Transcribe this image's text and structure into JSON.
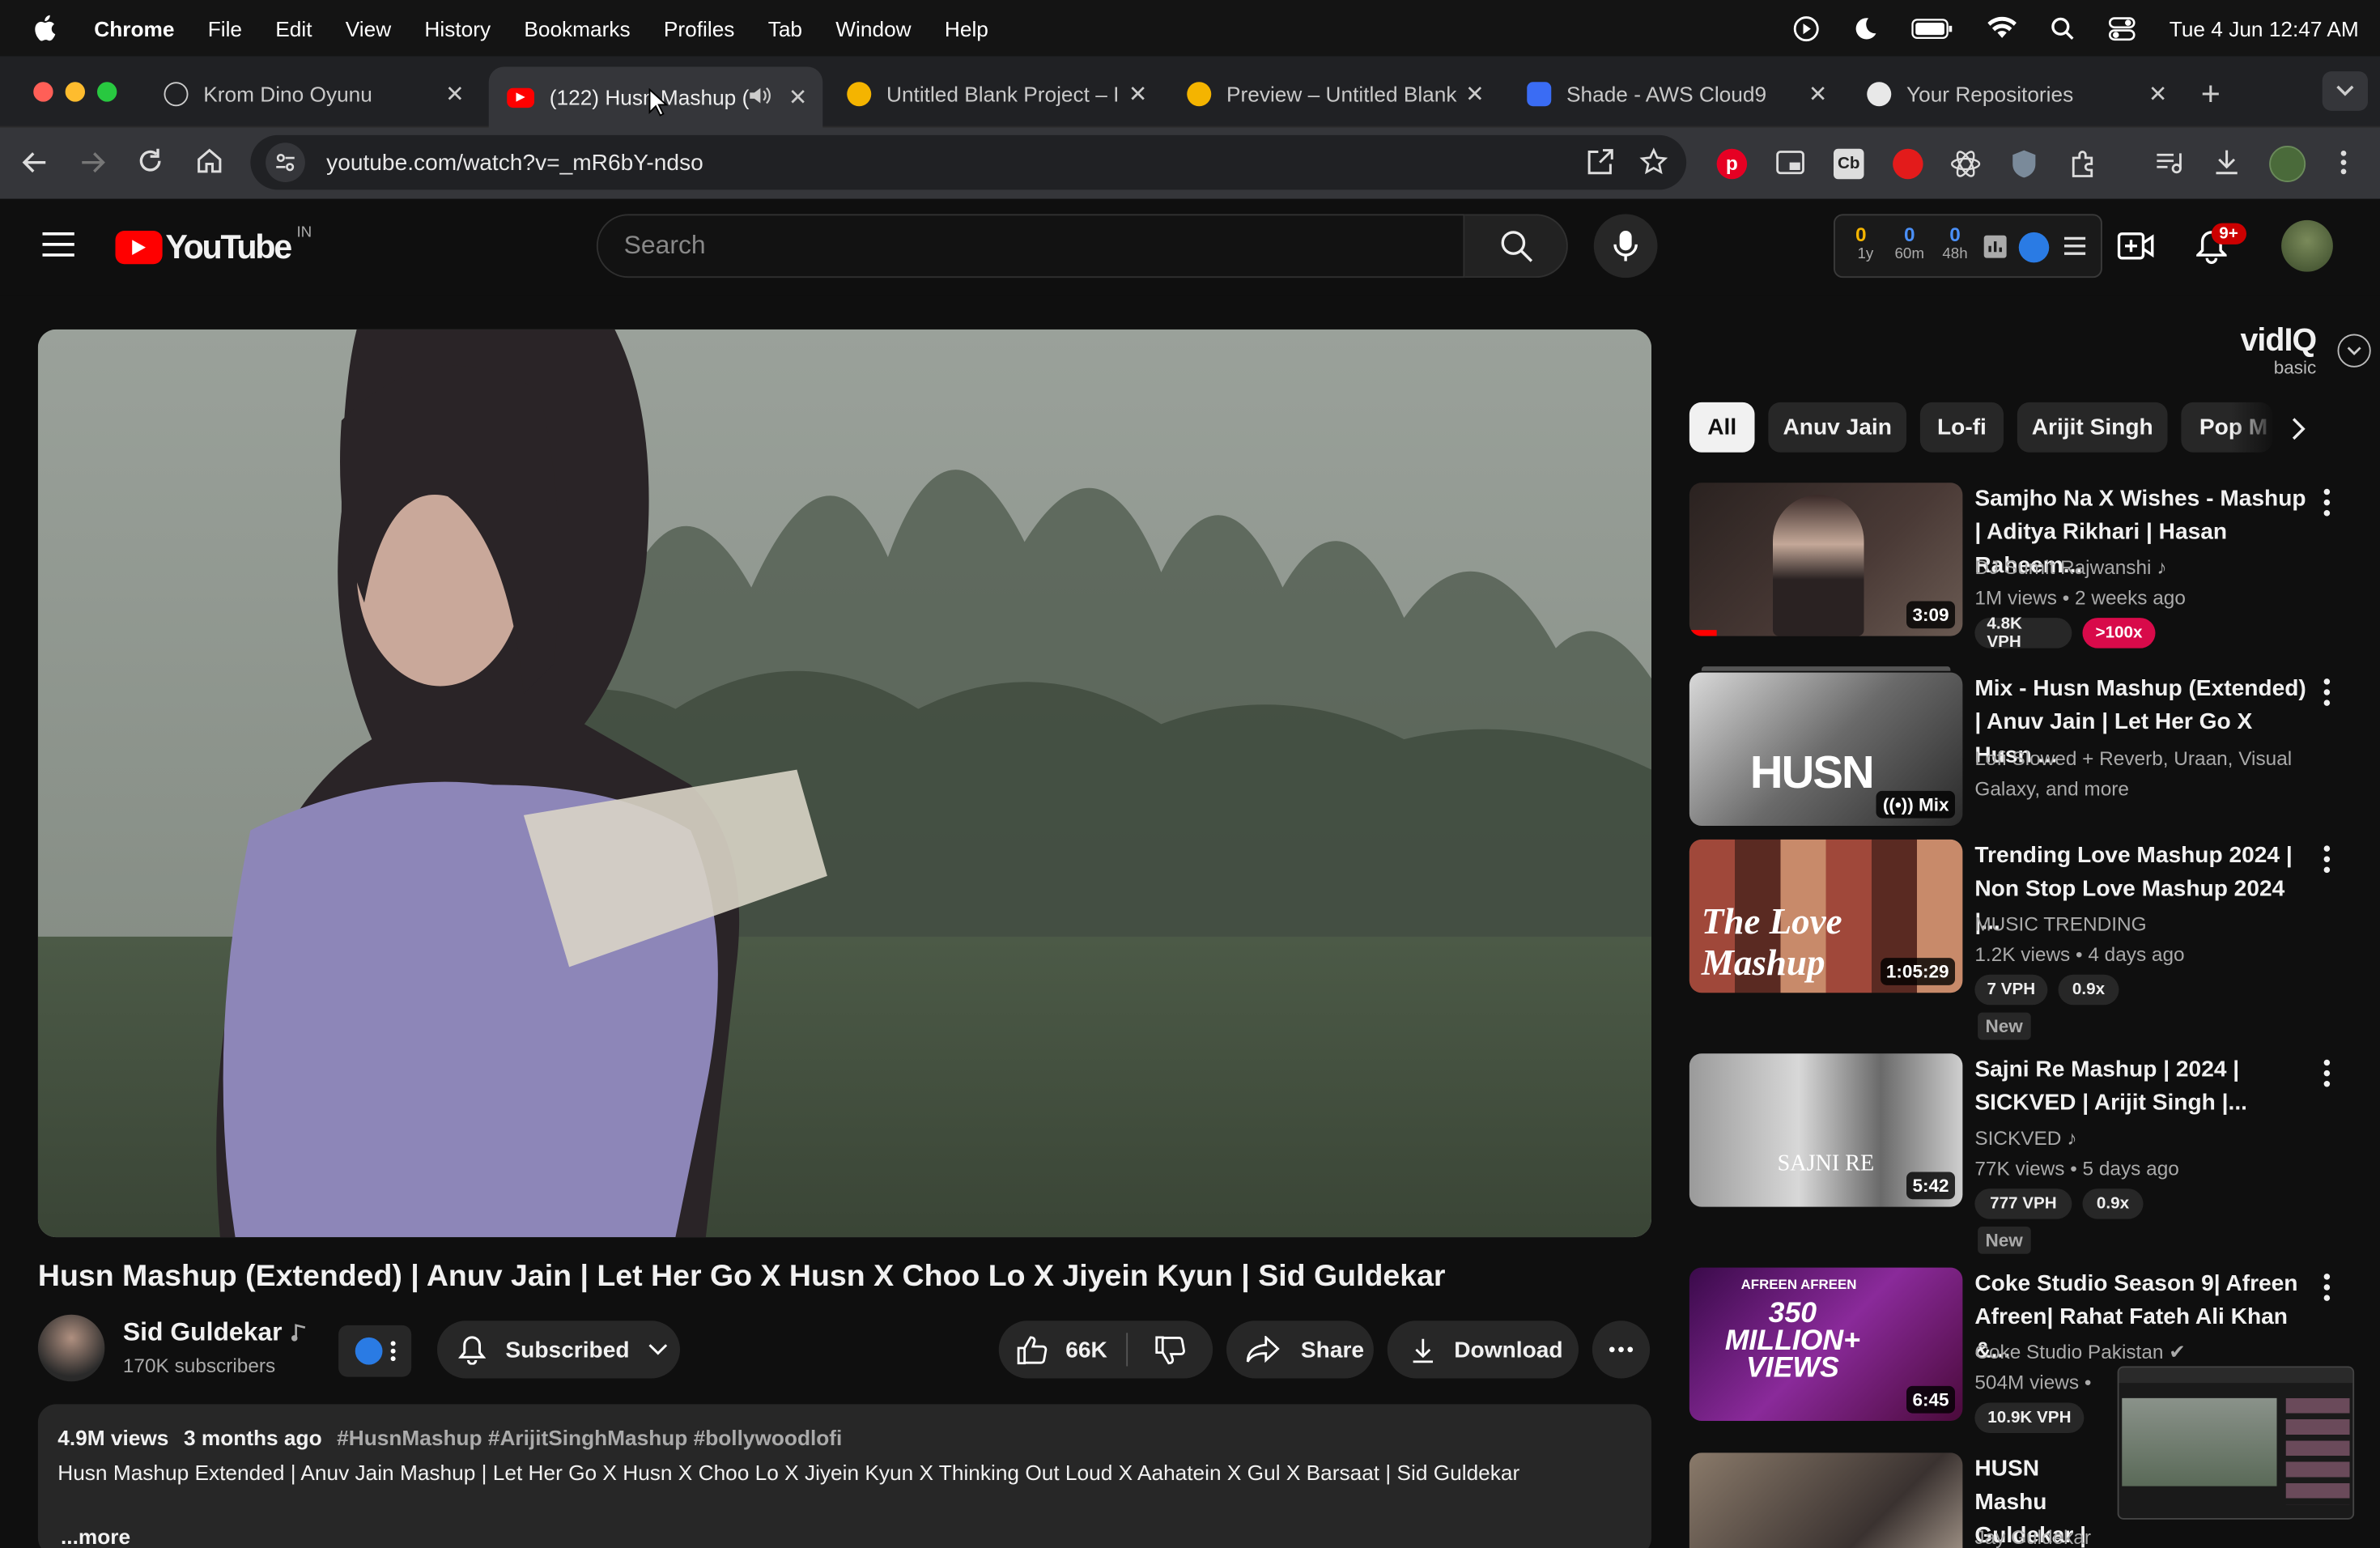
{
  "menubar": {
    "app": "Chrome",
    "items": [
      "File",
      "Edit",
      "View",
      "History",
      "Bookmarks",
      "Profiles",
      "Tab",
      "Window",
      "Help"
    ],
    "clock": "Tue 4 Jun  12:47 AM"
  },
  "tabs": [
    {
      "title": "Krom Dino Oyunu",
      "favicon": "openai-icon"
    },
    {
      "title": "(122) Husn Mashup (",
      "favicon": "youtube-icon"
    },
    {
      "title": "Untitled Blank Project – I",
      "favicon": "replit-icon"
    },
    {
      "title": "Preview – Untitled Blank",
      "favicon": "replit-icon"
    },
    {
      "title": "Shade - AWS Cloud9",
      "favicon": "cloud9-icon"
    },
    {
      "title": "Your Repositories",
      "favicon": "github-icon"
    }
  ],
  "toolbar": {
    "url": "youtube.com/watch?v=_mR6bY-ndso"
  },
  "youtube": {
    "logo_text": "YouTube",
    "country": "IN",
    "search_placeholder": "Search",
    "notifications": "9+",
    "vidiq": {
      "stats": [
        {
          "value": "0",
          "label": "1y"
        },
        {
          "value": "0",
          "label": "60m"
        },
        {
          "value": "0",
          "label": "48h"
        }
      ],
      "brand": "vidIQ",
      "plan": "basic"
    }
  },
  "video": {
    "title": "Husn Mashup (Extended) | Anuv Jain | Let Her Go X Husn X Choo Lo X Jiyein Kyun | Sid Guldekar",
    "channel": "Sid Guldekar",
    "subscribers": "170K subscribers",
    "subscribed_label": "Subscribed",
    "likes": "66K",
    "share_label": "Share",
    "download_label": "Download",
    "views": "4.9M views",
    "age": "3 months ago",
    "hashtags": "#HusnMashup #ArijitSinghMashup #bollywoodlofi",
    "description": "Husn Mashup Extended | Anuv Jain Mashup | Let Her Go X Husn X Choo Lo X Jiyein Kyun X Thinking Out Loud X Aahatein X Gul X Barsaat | Sid Guldekar",
    "more": "...more"
  },
  "chips": [
    "All",
    "Anuv Jain",
    "Lo-fi",
    "Arijit Singh",
    "Pop M"
  ],
  "recommendations": [
    {
      "title": "Samjho Na X Wishes - Mashup | Aditya Rikhari | Hasan Raheem...",
      "channel": "DJ Sumit Rajwanshi",
      "stats": "1M views  • 2 weeks ago",
      "duration": "3:09",
      "vph": "4.8K VPH",
      "ratio": ">100x",
      "thumb_color": "#3b3230"
    },
    {
      "title": "Mix - Husn Mashup (Extended) | Anuv Jain | Let Her Go X Husn ...",
      "channel": "Lofi Slowed + Reverb, Uraan, Visual",
      "stats": "Galaxy, and more",
      "duration": "Mix",
      "thumb_color": "#8a8a8a"
    },
    {
      "title": "Trending Love Mashup 2024 | Non Stop Love Mashup 2024 |...",
      "channel": "MUSIC TRENDING",
      "stats": "1.2K views  • 4 days ago",
      "duration": "1:05:29",
      "vph": "7 VPH",
      "ratio": "0.9x",
      "new": "New",
      "thumb_color": "#7a4a3a"
    },
    {
      "title": "Sajni Re Mashup | 2024 | SICKVED | Arijit Singh |...",
      "channel": "SICKVED",
      "stats": "77K views  • 5 days ago",
      "duration": "5:42",
      "vph": "777 VPH",
      "ratio": "0.9x",
      "new": "New",
      "thumb_color": "#bdbdbd"
    },
    {
      "title": "Coke Studio Season 9| Afreen Afreen| Rahat Fateh Ali Khan &...",
      "channel": "Coke Studio Pakistan",
      "stats": "504M views  • ",
      "duration": "6:45",
      "vph": "10.9K VPH",
      "thumb_color": "#5a1e6a",
      "thumb_text": "350 MILLION+ VIEWS",
      "thumb_top": "AFREEN AFREEN"
    },
    {
      "title": "HUSN Mashu Guldekar | An",
      "channel": "Jay Guldekar",
      "thumb_color": "#6b5d52"
    }
  ]
}
